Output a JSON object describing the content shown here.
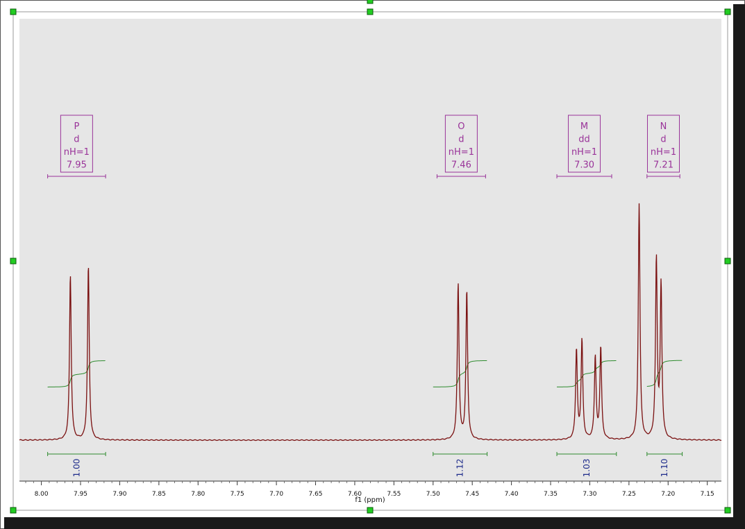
{
  "chart_data": {
    "type": "line",
    "title": "",
    "xlabel": "f1 (ppm)",
    "ylabel": "",
    "xlim": [
      8.028,
      7.132
    ],
    "x_reversed": true,
    "x_ticks": [
      "8.00",
      "7.95",
      "7.90",
      "7.85",
      "7.80",
      "7.75",
      "7.70",
      "7.65",
      "7.60",
      "7.55",
      "7.50",
      "7.45",
      "7.40",
      "7.35",
      "7.30",
      "7.25",
      "7.20",
      "7.15"
    ],
    "grid": false,
    "colors": {
      "spectrum": "#7a1010",
      "integral": "#2e8b2e",
      "multiplet": "#993399",
      "integral_value": "#1c2a8a",
      "plot_bg": "#e6e6e6"
    },
    "peaks": [
      {
        "ppm": 7.963,
        "height": 0.7
      },
      {
        "ppm": 7.94,
        "height": 0.74
      },
      {
        "ppm": 7.468,
        "height": 0.66
      },
      {
        "ppm": 7.457,
        "height": 0.63
      },
      {
        "ppm": 7.317,
        "height": 0.38
      },
      {
        "ppm": 7.31,
        "height": 0.42
      },
      {
        "ppm": 7.293,
        "height": 0.35
      },
      {
        "ppm": 7.286,
        "height": 0.39
      },
      {
        "ppm": 7.237,
        "height": 1.0
      },
      {
        "ppm": 7.215,
        "height": 0.76
      },
      {
        "ppm": 7.209,
        "height": 0.65
      }
    ],
    "multiplets": [
      {
        "label": "P",
        "mult": "d",
        "nH": "nH=1",
        "shift": "7.95",
        "range": [
          7.992,
          7.918
        ]
      },
      {
        "label": "O",
        "mult": "d",
        "nH": "nH=1",
        "shift": "7.46",
        "range": [
          7.495,
          7.433
        ]
      },
      {
        "label": "M",
        "mult": "dd",
        "nH": "nH=1",
        "shift": "7.30",
        "range": [
          7.342,
          7.272
        ]
      },
      {
        "label": "N",
        "mult": "d",
        "nH": "nH=1",
        "shift": "7.21",
        "range": [
          7.227,
          7.185
        ]
      }
    ],
    "integrals": [
      {
        "value": "1.00",
        "range": [
          7.992,
          7.918
        ]
      },
      {
        "value": "1.12",
        "range": [
          7.5,
          7.431
        ]
      },
      {
        "value": "1.03",
        "range": [
          7.342,
          7.266
        ]
      },
      {
        "value": "1.10",
        "range": [
          7.227,
          7.182
        ]
      }
    ]
  }
}
